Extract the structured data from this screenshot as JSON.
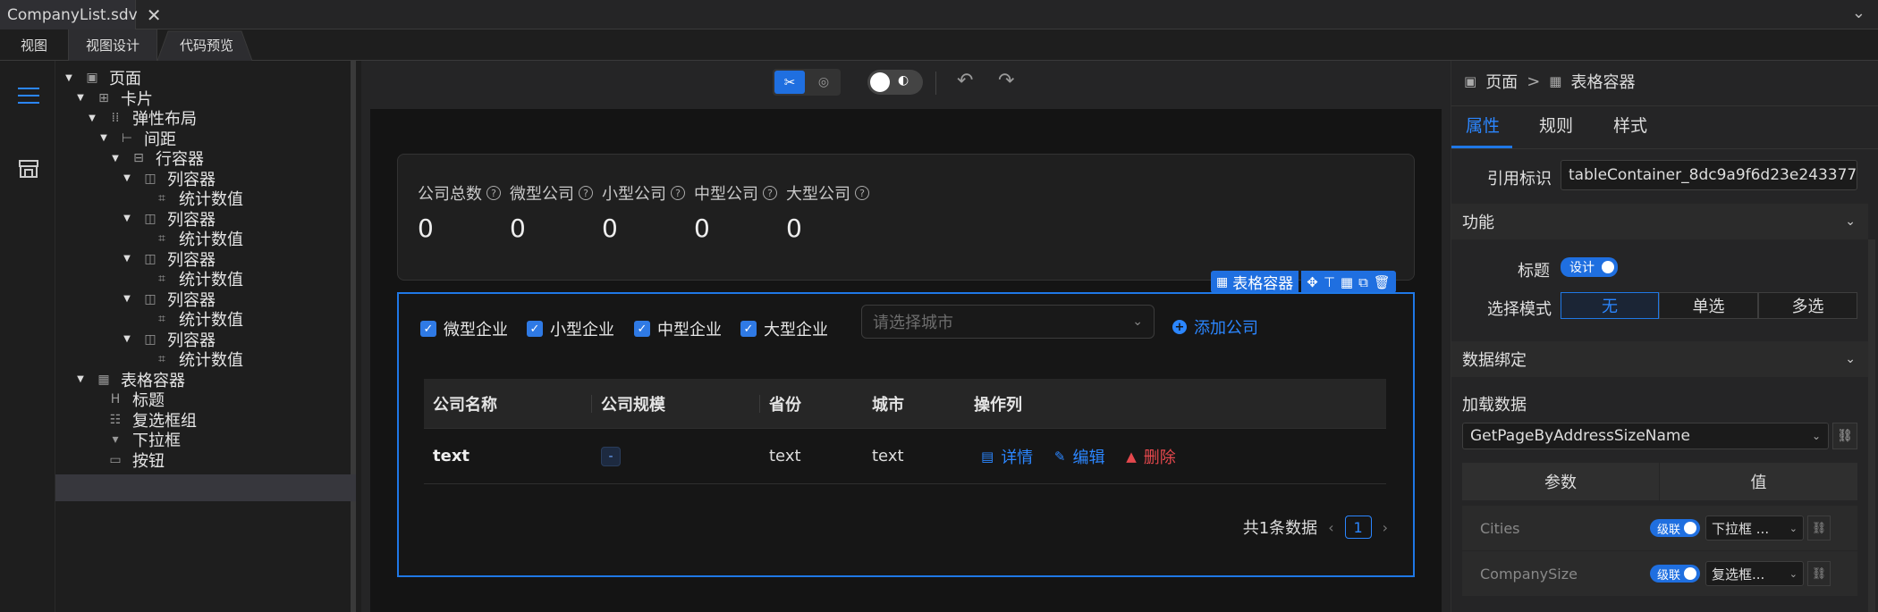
{
  "titlebar": {
    "file_name": "CompanyList.sdv"
  },
  "tabs": [
    "视图",
    "视图设计",
    "代码预览"
  ],
  "tree": [
    {
      "label": "页面",
      "icon": "page-icon",
      "arrow": true
    },
    {
      "label": "卡片",
      "icon": "card-icon",
      "arrow": true
    },
    {
      "label": "弹性布局",
      "icon": "flex-layout-icon",
      "arrow": true
    },
    {
      "label": "间距",
      "icon": "spacing-icon",
      "arrow": true
    },
    {
      "label": "行容器",
      "icon": "row-container-icon",
      "arrow": true
    },
    {
      "label": "列容器",
      "icon": "column-container-icon",
      "arrow": true
    },
    {
      "label": "统计数值",
      "icon": "statistic-icon",
      "arrow": false
    },
    {
      "label": "列容器",
      "icon": "column-container-icon",
      "arrow": true
    },
    {
      "label": "统计数值",
      "icon": "statistic-icon",
      "arrow": false
    },
    {
      "label": "列容器",
      "icon": "column-container-icon",
      "arrow": true
    },
    {
      "label": "统计数值",
      "icon": "statistic-icon",
      "arrow": false
    },
    {
      "label": "列容器",
      "icon": "column-container-icon",
      "arrow": true
    },
    {
      "label": "统计数值",
      "icon": "statistic-icon",
      "arrow": false
    },
    {
      "label": "列容器",
      "icon": "column-container-icon",
      "arrow": true
    },
    {
      "label": "统计数值",
      "icon": "statistic-icon",
      "arrow": false
    },
    {
      "label": "表格容器",
      "icon": "table-container-icon",
      "arrow": true
    },
    {
      "label": "标题",
      "icon": "heading-icon",
      "arrow": false
    },
    {
      "label": "复选框组",
      "icon": "checkbox-group-icon",
      "arrow": false
    },
    {
      "label": "下拉框",
      "icon": "dropdown-icon",
      "arrow": false
    },
    {
      "label": "按钮",
      "icon": "button-icon",
      "arrow": false
    }
  ],
  "stats": [
    {
      "label": "公司总数",
      "value": "0"
    },
    {
      "label": "微型公司",
      "value": "0"
    },
    {
      "label": "小型公司",
      "value": "0"
    },
    {
      "label": "中型公司",
      "value": "0"
    },
    {
      "label": "大型公司",
      "value": "0"
    }
  ],
  "table_container_badge": "表格容器",
  "filters": {
    "checkboxes": [
      "微型企业",
      "小型企业",
      "中型企业",
      "大型企业"
    ],
    "city_placeholder": "请选择城市",
    "add_button": "添加公司"
  },
  "table": {
    "headers": [
      "公司名称",
      "公司规模",
      "省份",
      "城市",
      "操作列"
    ],
    "row": {
      "name": "text",
      "size": "-",
      "province": "text",
      "city": "text"
    },
    "actions": {
      "detail": "详情",
      "edit": "编辑",
      "delete": "删除"
    }
  },
  "pager": {
    "total": "共1条数据",
    "page": "1"
  },
  "right_panel": {
    "breadcrumb": [
      "页面",
      "表格容器"
    ],
    "breadcrumb_sep": ">",
    "tabs": [
      "属性",
      "规则",
      "样式"
    ],
    "ref_label": "引用标识",
    "ref_value": "tableContainer_8dc9a9f6d23e243377",
    "function_section": "功能",
    "title_label": "标题",
    "title_toggle": "设计",
    "select_mode_label": "选择模式",
    "select_modes": [
      "无",
      "单选",
      "多选"
    ],
    "binding_section": "数据绑定",
    "load_data_label": "加载数据",
    "load_data_value": "GetPageByAddressSizeName",
    "param_header": "参数",
    "value_header": "值",
    "params": [
      {
        "name": "Cities",
        "toggle": "级联",
        "select": "下拉框 ..."
      },
      {
        "name": "CompanySize",
        "toggle": "级联",
        "select": "复选框..."
      }
    ]
  },
  "colors": {
    "accent": "#1f78e6",
    "delete": "#e5484d",
    "ok": "#3fb950"
  }
}
